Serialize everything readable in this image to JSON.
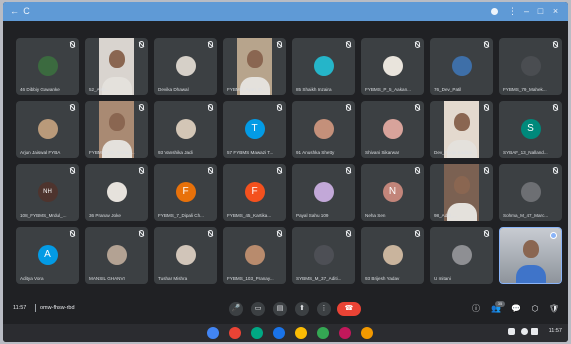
{
  "colors": {
    "window_bar": "#5f9ad6",
    "tile_bg": "#3c4043",
    "end_call": "#ea4335",
    "pin_accent": "#8ab4f8"
  },
  "participants": [
    {
      "name": "46 Dibbiy Gawanke",
      "kind": "image",
      "color": "#3b6a3f"
    },
    {
      "name": "52_Aish...",
      "kind": "video",
      "color": "#d9d4cf"
    },
    {
      "name": "Devika Dhawal",
      "kind": "image",
      "color": "#d6d0c8"
    },
    {
      "name": "FYBMS_Ayan_D...",
      "kind": "video",
      "color": "#b7a48c"
    },
    {
      "name": "85 Shaikh Inzaira",
      "kind": "image",
      "color": "#25b5c9"
    },
    {
      "name": "FYBMS_P_5_Aakan...",
      "kind": "image",
      "color": "#e9e4dc"
    },
    {
      "name": "76_Dev_Patil",
      "kind": "image",
      "color": "#3e6fa8"
    },
    {
      "name": "FYBMS_79_Mahek...",
      "kind": "image",
      "color": "#4a4d51"
    },
    {
      "name": "Arjun Jaiswal FYBA",
      "kind": "image",
      "color": "#b99a7a"
    },
    {
      "name": "FYBMS_AD_Archan...",
      "kind": "video",
      "color": "#a98a73"
    },
    {
      "name": "93 Vanshika Jadi",
      "kind": "image",
      "color": "#d3c6b6"
    },
    {
      "name": "57 FYBMS Mawazi T...",
      "kind": "letter",
      "letter": "T",
      "color": "#039be5"
    },
    {
      "name": "91 Anushka Shetty",
      "kind": "image",
      "color": "#c4907a"
    },
    {
      "name": "Shivani Sikarwar",
      "kind": "image",
      "color": "#d8a39b"
    },
    {
      "name": "Dev_Pooja Kadam",
      "kind": "video",
      "color": "#e3d9ce"
    },
    {
      "name": "SYBAF_13_Nalland...",
      "kind": "letter",
      "letter": "S",
      "color": "#00897b"
    },
    {
      "name": "108_FYBMS_Mrdul_...",
      "kind": "letter",
      "letter": "NH",
      "color": "#4e342e"
    },
    {
      "name": "36 Pranav Joke",
      "kind": "image",
      "color": "#e6e2dc"
    },
    {
      "name": "FYBMS_7_Dipali Ch...",
      "kind": "letter",
      "letter": "F",
      "color": "#e8710a"
    },
    {
      "name": "FYBMS_45_Kartika...",
      "kind": "letter",
      "letter": "F",
      "color": "#f4511e"
    },
    {
      "name": "Payal Sahu 109",
      "kind": "image",
      "color": "#c2a8d8"
    },
    {
      "name": "Neha Sen",
      "kind": "letter",
      "letter": "N",
      "color": "#c2857a"
    },
    {
      "name": "98_Aditi_...",
      "kind": "video",
      "color": "#7b6152"
    },
    {
      "name": "Sohma_M_47_Marc...",
      "kind": "image",
      "color": "#6d6f73"
    },
    {
      "name": "Aditya Vora",
      "kind": "letter",
      "letter": "A",
      "color": "#039be5"
    },
    {
      "name": "MANSIL GHANVI",
      "kind": "image",
      "color": "#b3a293"
    },
    {
      "name": "Tushar Mishra",
      "kind": "image",
      "color": "#d1c5b9"
    },
    {
      "name": "FYBMS_103_Pranay...",
      "kind": "image",
      "color": "#b88b6d"
    },
    {
      "name": "SYBMS_M_37_Aditi...",
      "kind": "image",
      "color": "#4d4f55"
    },
    {
      "name": "93 Brijesh Yadav",
      "kind": "image",
      "color": "#c9b49d"
    },
    {
      "name": "U mitani",
      "kind": "image",
      "color": "#8e8f93"
    },
    {
      "name": "",
      "kind": "pinned",
      "color": "#3f74c9"
    }
  ],
  "meeting": {
    "time": "11:57",
    "code": "omw-fhsw-rbd",
    "participants_count": "35"
  },
  "controls": {
    "mic": "🎤",
    "camera": "▭",
    "captions": "▤",
    "present": "⬆",
    "more": "⋮",
    "end": "☎",
    "info": "ⓘ",
    "people": "👥",
    "chat": "💬",
    "activities": "⬡",
    "host": "🛡"
  },
  "shelf": {
    "clock": "11:57",
    "apps": [
      {
        "name": "chrome",
        "color": "#4285f4"
      },
      {
        "name": "gmail",
        "color": "#ea4335"
      },
      {
        "name": "meet",
        "color": "#00a884"
      },
      {
        "name": "files",
        "color": "#1a73e8"
      },
      {
        "name": "docs",
        "color": "#fbbc04"
      },
      {
        "name": "play-store",
        "color": "#34a853"
      },
      {
        "name": "camera",
        "color": "#c2185b"
      },
      {
        "name": "photos",
        "color": "#f29900"
      }
    ]
  },
  "window": {
    "back_glyph": "←",
    "refresh_glyph": "C",
    "minimize_glyph": "–",
    "maximize_glyph": "□",
    "close_glyph": "×"
  }
}
